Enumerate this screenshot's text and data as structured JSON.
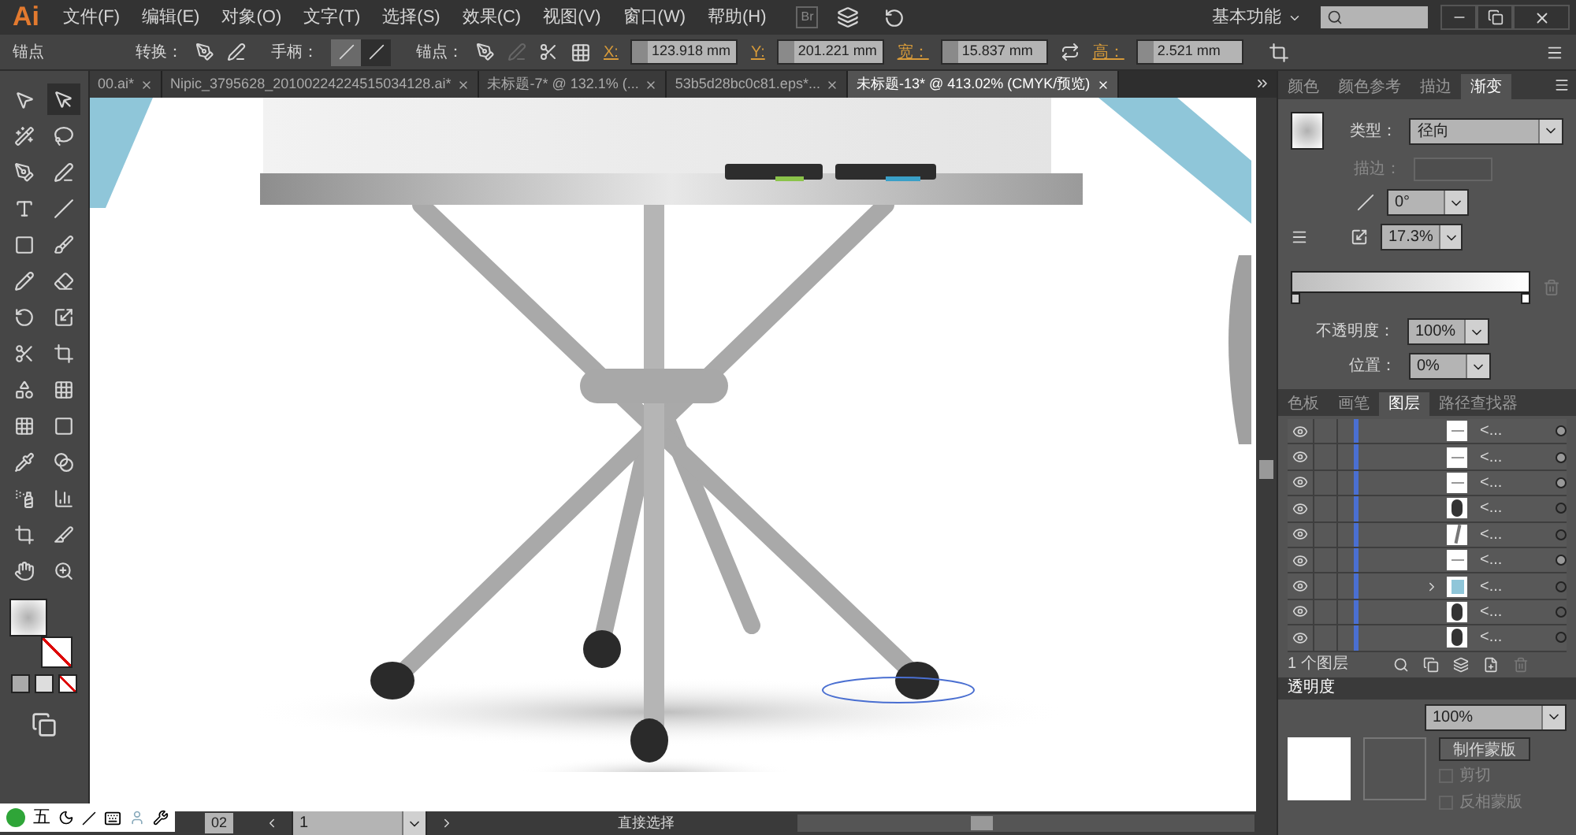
{
  "app": {
    "logo": "Ai",
    "menu": [
      "文件(F)",
      "编辑(E)",
      "对象(O)",
      "文字(T)",
      "选择(S)",
      "效果(C)",
      "视图(V)",
      "窗口(W)",
      "帮助(H)"
    ],
    "bridge": "Br",
    "workspace": "基本功能"
  },
  "control_bar": {
    "selection": "锚点",
    "convert_label": "转换：",
    "handles_label": "手柄：",
    "handle_toggles": [
      {
        "selected": true
      },
      {
        "selected": false
      }
    ],
    "anchors_label": "锚点：",
    "fields": [
      {
        "label": "X:",
        "value": "123.918 mm"
      },
      {
        "label": "Y:",
        "value": "201.221 mm"
      },
      {
        "label": "宽：",
        "value": "15.837 mm"
      },
      {
        "label": "高：",
        "value": "2.521 mm"
      }
    ]
  },
  "tabs": [
    {
      "label": "00.ai*",
      "selected": false
    },
    {
      "label": "Nipic_3795628_20100224224515034128.ai*",
      "selected": false
    },
    {
      "label": "未标题-7* @ 132.1% (...",
      "selected": false
    },
    {
      "label": "53b5d28bc0c81.eps*...",
      "selected": false
    },
    {
      "label": "未标题-13* @ 413.02% (CMYK/预览)",
      "selected": true
    }
  ],
  "gradient_panel": {
    "tabs": [
      {
        "label": "颜色",
        "selected": false
      },
      {
        "label": "颜色参考",
        "selected": false
      },
      {
        "label": "描边",
        "selected": false
      },
      {
        "label": "渐变",
        "selected": true
      }
    ],
    "type_label": "类型：",
    "type_value": "径向",
    "stroke_label": "描边：",
    "angle": "0°",
    "aspect": "17.3%",
    "opacity_label": "不透明度：",
    "opacity": "100%",
    "location_label": "位置：",
    "location": "0%"
  },
  "layers_panel": {
    "tabs": [
      {
        "label": "色板",
        "selected": false
      },
      {
        "label": "画笔",
        "selected": false
      },
      {
        "label": "图层",
        "selected": true
      },
      {
        "label": "路径查找器",
        "selected": false
      }
    ],
    "rows": [
      {
        "name": "<...",
        "visible": true,
        "kind": "line",
        "expandable": false,
        "targeted": true
      },
      {
        "name": "<...",
        "visible": true,
        "kind": "line",
        "expandable": false,
        "targeted": true
      },
      {
        "name": "<...",
        "visible": true,
        "kind": "line",
        "expandable": false,
        "targeted": true
      },
      {
        "name": "<...",
        "visible": true,
        "kind": "foot",
        "expandable": false,
        "targeted": false
      },
      {
        "name": "<...",
        "visible": true,
        "kind": "leg",
        "expandable": false,
        "targeted": false
      },
      {
        "name": "<...",
        "visible": true,
        "kind": "line",
        "expandable": false,
        "targeted": true
      },
      {
        "name": "<...",
        "visible": true,
        "kind": "shape",
        "expandable": true,
        "targeted": false
      },
      {
        "name": "<...",
        "visible": true,
        "kind": "foot",
        "expandable": false,
        "targeted": false
      },
      {
        "name": "<...",
        "visible": true,
        "kind": "foot",
        "expandable": false,
        "targeted": false
      }
    ],
    "footer": "1 个图层"
  },
  "transparency_panel": {
    "title": "透明度",
    "opacity": "100%",
    "make_mask": "制作蒙版",
    "options": [
      {
        "label": "剪切",
        "checked": false,
        "disabled": true
      },
      {
        "label": "反相蒙版",
        "checked": false,
        "disabled": true
      }
    ]
  },
  "status_bar": {
    "zoom": "02",
    "page": "1",
    "tool": "直接选择"
  },
  "ime_bar": {
    "mode": "五"
  }
}
